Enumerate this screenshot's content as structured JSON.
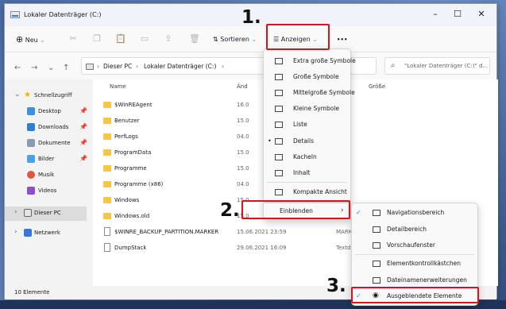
{
  "window": {
    "title": "Lokaler Datenträger (C:)"
  },
  "toolbar": {
    "new_label": "Neu",
    "sort_label": "Sortieren",
    "view_label": "Anzeigen",
    "more_label": "•••"
  },
  "address": {
    "this_pc": "Dieser PC",
    "drive": "Lokaler Datenträger (C:)",
    "search_placeholder": "\"Lokaler Datenträger (C:)\" d..."
  },
  "sidebar": {
    "quick_access": "Schnellzugriff",
    "items": [
      {
        "label": "Desktop",
        "color": "#3d8ee0",
        "pinned": true
      },
      {
        "label": "Downloads",
        "color": "#2f7fd0",
        "pinned": true
      },
      {
        "label": "Dokumente",
        "color": "#8a9bb0",
        "pinned": true
      },
      {
        "label": "Bilder",
        "color": "#4aa3e8",
        "pinned": true
      },
      {
        "label": "Musik",
        "color": "#e0553d",
        "pinned": false
      },
      {
        "label": "Videos",
        "color": "#8b4fd0",
        "pinned": false
      }
    ],
    "this_pc": "Dieser PC",
    "network": "Netzwerk"
  },
  "columns": {
    "name": "Name",
    "date": "Änd",
    "size": "Größe"
  },
  "files": [
    {
      "name": "$WinREAgent",
      "date": "16.0",
      "type": "",
      "kind": "folder"
    },
    {
      "name": "Benutzer",
      "date": "15.0",
      "type": "",
      "kind": "folder"
    },
    {
      "name": "PerfLogs",
      "date": "04.0",
      "type": "",
      "kind": "folder"
    },
    {
      "name": "ProgramData",
      "date": "15.0",
      "type": "",
      "kind": "folder"
    },
    {
      "name": "Programme",
      "date": "15.0",
      "type": "",
      "kind": "folder"
    },
    {
      "name": "Programme (x86)",
      "date": "04.0",
      "type": "",
      "kind": "folder"
    },
    {
      "name": "Windows",
      "date": "15.0",
      "type": "",
      "kind": "folder"
    },
    {
      "name": "Windows.old",
      "date": "15.0",
      "type": "",
      "kind": "folder"
    },
    {
      "name": "$WINRE_BACKUP_PARTITION.MARKER",
      "date": "15.06.2021 23:59",
      "type": "MARKER-Datei",
      "kind": "file"
    },
    {
      "name": "DumpStack",
      "date": "29.06.2021 16:09",
      "type": "Textdokument",
      "kind": "file"
    }
  ],
  "status": {
    "count": "10 Elemente"
  },
  "view_menu": {
    "items": [
      {
        "label": "Extra große Symbole",
        "selected": false
      },
      {
        "label": "Große Symbole",
        "selected": false
      },
      {
        "label": "Mittelgroße Symbole",
        "selected": false
      },
      {
        "label": "Kleine Symbole",
        "selected": false
      },
      {
        "label": "Liste",
        "selected": false
      },
      {
        "label": "Details",
        "selected": true
      },
      {
        "label": "Kacheln",
        "selected": false
      },
      {
        "label": "Inhalt",
        "selected": false
      },
      {
        "label": "Kompakte Ansicht",
        "selected": false
      },
      {
        "label": "Einblenden",
        "selected": false
      }
    ],
    "selected_bullet": "•"
  },
  "show_menu": {
    "items": [
      {
        "label": "Navigationsbereich",
        "checked": true
      },
      {
        "label": "Detailbereich",
        "checked": false
      },
      {
        "label": "Vorschaufenster",
        "checked": false
      },
      {
        "label": "Elementkontrollkästchen",
        "checked": false
      },
      {
        "label": "Dateinamenerweiterungen",
        "checked": false
      },
      {
        "label": "Ausgeblendete Elemente",
        "checked": true
      }
    ]
  },
  "annotations": [
    "1.",
    "2.",
    "3."
  ],
  "highlight_color": "#e0101a"
}
